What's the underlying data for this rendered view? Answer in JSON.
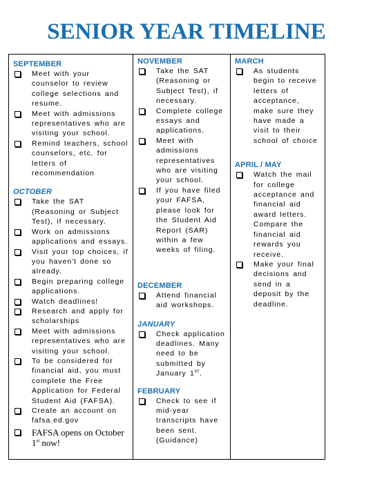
{
  "title": "SENIOR YEAR TIMELINE",
  "columns": [
    {
      "sections": [
        {
          "month": "SEPTEMBER",
          "items": [
            "Meet with your counselor to review college selections and resume.",
            "Meet with admissions representatives who are visiting your school.",
            "Remind teachers, school counselors, etc. for letters of recommendation"
          ]
        },
        {
          "month": "OCTOBER",
          "items": [
            "Take the SAT (Reasoning or Subject Test), if necessary.",
            "Work on admissions applications and essays.",
            "Visit your top choices, if you haven't done so already.",
            "Begin preparing college applications.",
            "Watch deadlines!",
            "Research and apply for scholarships",
            "Meet with admissions representatives who are visiting your school.",
            "To be considered for financial aid, you must complete the Free Application for Federal Student Aid (FAFSA).",
            "Create an account on fafsa.ed.gov"
          ],
          "last_item": {
            "text": "FAFSA opens on October 1",
            "sup": "st",
            "tail": " now!"
          }
        }
      ]
    },
    {
      "sections": [
        {
          "month": "NOVEMBER",
          "items": [
            "Take the SAT (Reasoning or Subject Test), if necessary.",
            "Complete college essays and applications.",
            "Meet with admissions representatives who are visiting your school.",
            "If you have filed your FAFSA, please look for the Student Aid Report (SAR) within a few weeks of filing."
          ]
        },
        {
          "month": "DECEMBER",
          "items": [
            "Attend financial aid workshops."
          ]
        },
        {
          "month": "JANUARY",
          "items": [],
          "last_item": {
            "text": "Check application deadlines. Many need to be submitted by January 1",
            "sup": "st",
            "tail": "."
          }
        },
        {
          "month": "FEBRUARY",
          "items": [
            "Check to see if mid-year transcripts have been sent. (Guidance)"
          ]
        }
      ]
    },
    {
      "sections": [
        {
          "month": "MARCH",
          "items": [
            "As students begin to receive letters of acceptance, make sure they have made a visit to their school of choice"
          ]
        },
        {
          "month": "APRIL / MAY",
          "items": [
            "Watch the mail for college acceptance and financial aid award letters. Compare the financial aid rewards you receive.",
            "Make your final decisions and send in a deposit by the deadline."
          ]
        }
      ]
    }
  ],
  "checkbox_icon": "checkbox-icon",
  "accent_color": "#1a6faf"
}
